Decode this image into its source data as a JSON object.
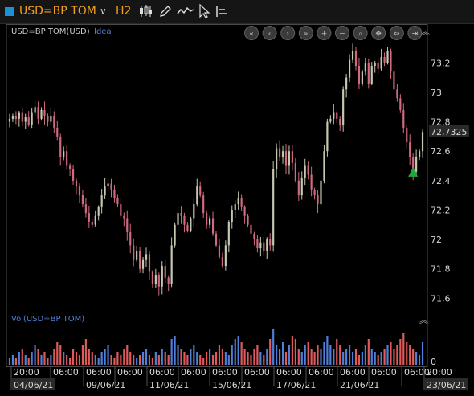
{
  "toolbar": {
    "symbol": "USD=BP TOM",
    "interval": "H2",
    "tools": [
      "candlestick-icon",
      "pencil-icon",
      "line-style-icon",
      "cursor-icon",
      "layout-icon"
    ]
  },
  "price_panel": {
    "title": "USD=BP TOM(USD)",
    "idea_link": "Idea",
    "nav_buttons": [
      "rewind-icon",
      "back-icon",
      "forward-icon",
      "fast-forward-icon",
      "zoom-in-icon",
      "zoom-out-icon",
      "zoom-fit-icon",
      "pan-icon",
      "expand-icon",
      "end-icon"
    ],
    "last_price_label": "72,7325"
  },
  "volume_panel": {
    "title": "Vol(USD=BP TOM)",
    "zero_label": "0"
  },
  "colors": {
    "up_candle": "#c8c8b0",
    "down_candle": "#d06a80",
    "vol_up": "#4f7fd8",
    "vol_down": "#e05a5a",
    "arrow": "#22a83a"
  },
  "chart_data": {
    "type": "candlestick",
    "y_ticks": [
      "71,6",
      "71,8",
      "72",
      "72,2",
      "72,4",
      "72,6",
      "72,8",
      "73",
      "73,2"
    ],
    "ylim": [
      71.52,
      73.42
    ],
    "x_time_labels": [
      "20:00",
      "06:00",
      "06:00",
      "06:00",
      "06:00",
      "06:00",
      "06:00",
      "06:00",
      "06:00",
      "06:00",
      "06:00",
      "06:00",
      "06:00",
      "20:00"
    ],
    "x_date_labels": [
      "04/06/21",
      "09/06/21",
      "11/06/21",
      "15/06/21",
      "17/06/21",
      "21/06/21",
      "23/06/21"
    ],
    "close": [
      72.82,
      72.84,
      72.82,
      72.86,
      72.8,
      72.83,
      72.78,
      72.86,
      72.9,
      72.82,
      72.88,
      72.84,
      72.8,
      72.84,
      72.76,
      72.7,
      72.56,
      72.6,
      72.5,
      72.48,
      72.4,
      72.36,
      72.3,
      72.24,
      72.18,
      72.12,
      72.1,
      72.16,
      72.22,
      72.3,
      72.36,
      72.38,
      72.34,
      72.28,
      72.24,
      72.16,
      72.14,
      72.05,
      71.96,
      71.86,
      71.92,
      71.8,
      71.86,
      71.9,
      71.78,
      71.7,
      71.76,
      71.68,
      71.82,
      71.74,
      71.7,
      71.96,
      72.1,
      72.18,
      72.16,
      72.1,
      72.06,
      72.14,
      72.24,
      72.36,
      72.3,
      72.18,
      72.1,
      72.14,
      72.04,
      71.96,
      71.88,
      71.82,
      71.96,
      72.12,
      72.2,
      72.24,
      72.28,
      72.22,
      72.16,
      72.1,
      72.04,
      72.0,
      71.94,
      71.98,
      71.92,
      72.0,
      71.96,
      72.48,
      72.62,
      72.56,
      72.6,
      72.5,
      72.6,
      72.52,
      72.4,
      72.3,
      72.42,
      72.5,
      72.44,
      72.34,
      72.3,
      72.24,
      72.4,
      72.6,
      72.8,
      72.82,
      72.86,
      72.82,
      72.78,
      73.02,
      73.1,
      73.22,
      73.28,
      73.18,
      73.06,
      73.14,
      73.2,
      73.06,
      73.18,
      73.2,
      73.16,
      73.24,
      73.2,
      73.28,
      73.14,
      73.02,
      72.96,
      72.88,
      72.76,
      72.66,
      72.56,
      72.46,
      72.56,
      72.6,
      72.73
    ],
    "volume": [
      2,
      3,
      2,
      4,
      5,
      3,
      2,
      4,
      6,
      5,
      3,
      4,
      2,
      3,
      5,
      7,
      6,
      4,
      3,
      2,
      5,
      4,
      3,
      6,
      8,
      5,
      4,
      3,
      2,
      4,
      5,
      6,
      3,
      2,
      4,
      3,
      5,
      6,
      4,
      3,
      2,
      3,
      4,
      5,
      3,
      2,
      4,
      3,
      5,
      4,
      3,
      8,
      9,
      6,
      5,
      4,
      3,
      5,
      6,
      4,
      3,
      2,
      4,
      5,
      3,
      4,
      6,
      5,
      4,
      3,
      6,
      8,
      9,
      7,
      5,
      4,
      3,
      5,
      6,
      4,
      3,
      5,
      8,
      11,
      6,
      5,
      7,
      4,
      6,
      9,
      8,
      5,
      4,
      6,
      7,
      5,
      4,
      6,
      5,
      7,
      9,
      6,
      5,
      8,
      6,
      4,
      5,
      6,
      4,
      5,
      3,
      4,
      6,
      8,
      5,
      4,
      3,
      4,
      5,
      6,
      7,
      5,
      6,
      8,
      10,
      7,
      6,
      5,
      4,
      3,
      7
    ],
    "last_price": 72.7325
  }
}
